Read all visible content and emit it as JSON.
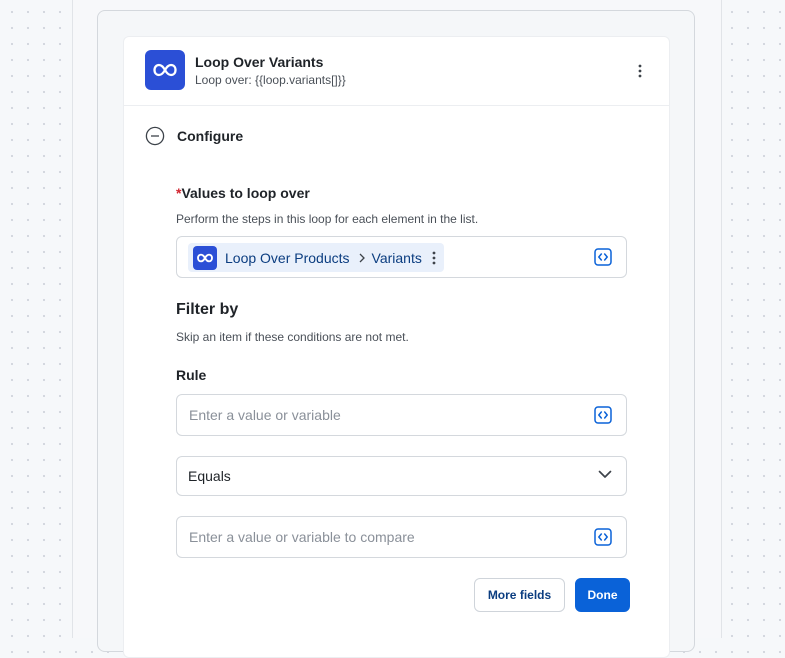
{
  "step": {
    "icon": "infinity-loop-icon",
    "title": "Loop Over Variants",
    "subtitle": "Loop over: {{loop.variants[]}}"
  },
  "configure": {
    "label": "Configure",
    "toggle_icon": "minus-circle-icon"
  },
  "values_field": {
    "required_marker": "*",
    "label": "Values to loop over",
    "help": "Perform the steps in this loop for each element in the list.",
    "pill": {
      "icon": "infinity-loop-icon",
      "source": "Loop Over Products",
      "separator_icon": "chevron-right-icon",
      "field": "Variants",
      "menu_icon": "vertical-dots-icon"
    },
    "variable_icon": "code-brackets-icon"
  },
  "filter": {
    "title": "Filter by",
    "help": "Skip an item if these conditions are not met.",
    "rule_label": "Rule",
    "rule_placeholder": "Enter a value or variable",
    "operator": "Equals",
    "compare_placeholder": "Enter a value or variable to compare",
    "variable_icon": "code-brackets-icon"
  },
  "actions": {
    "more_fields": "More fields",
    "done": "Done"
  },
  "colors": {
    "accent": "#2b4fd6",
    "primary_button": "#0a62d8",
    "pill_background": "#e9f0fb",
    "required": "#d1242f"
  }
}
